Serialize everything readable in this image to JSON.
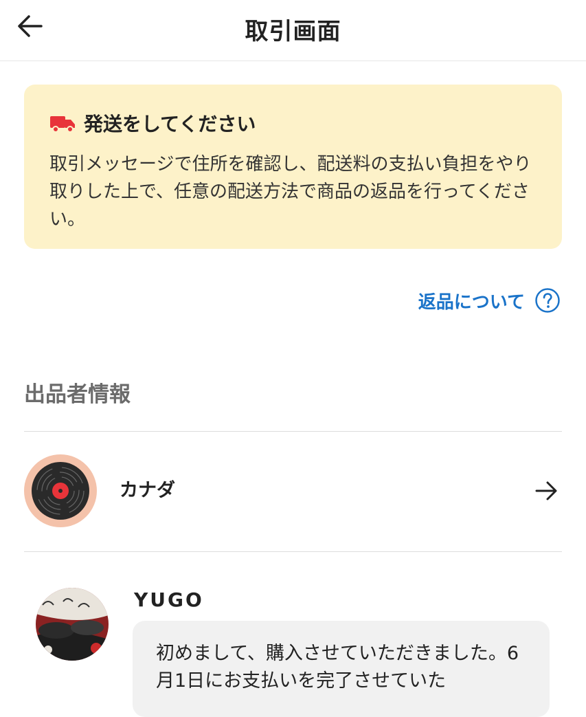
{
  "header": {
    "title": "取引画面",
    "back_icon": "arrow-left-icon"
  },
  "notice": {
    "icon": "truck-icon",
    "icon_color": "#e8343a",
    "title": "発送をしてください",
    "body": "取引メッセージで住所を確認し、配送料の支払い負担をやり取りした上で、任意の配送方法で商品の返品を行ってください。",
    "background": "#fdf2c9"
  },
  "help_link": {
    "label": "返品について",
    "icon": "help-circle-icon",
    "color": "#1a73c9"
  },
  "seller_section": {
    "title": "出品者情報"
  },
  "seller": {
    "name": "カナダ",
    "avatar_icon": "vinyl-record-icon",
    "arrow_icon": "arrow-right-icon"
  },
  "message": {
    "sender": "YUGO",
    "text": "初めまして、購入させていただきました。6月1日にお支払いを完了させていた"
  }
}
